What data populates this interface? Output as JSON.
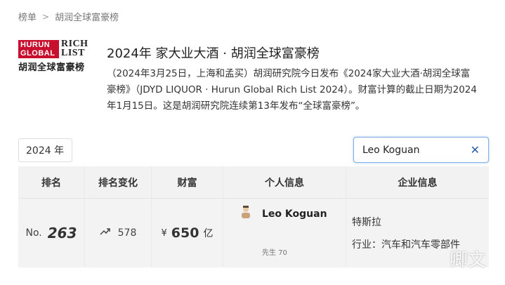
{
  "breadcrumb": {
    "items": [
      "榜单",
      "胡润全球富豪榜"
    ],
    "separator": ">"
  },
  "logo": {
    "left_text": "HURUN GLOBAL",
    "right_text": "RICH LIST",
    "cn_text": "胡润全球富豪榜"
  },
  "title": "2024年 家大业大酒 · 胡润全球富豪榜",
  "description": "（2024年3月25日，上海和孟买）胡润研究院今日发布《2024家大业大酒·胡润全球富豪榜》（JDYD LIQUOR · Hurun Global Rich List 2024）。财富计算的截止日期为2024年1月15日。这是胡润研究院连续第13年发布“全球富豪榜”。",
  "filters": {
    "year": "2024 年",
    "search_value": "Leo Koguan",
    "clear_icon": "close-icon"
  },
  "table": {
    "headers": [
      "排名",
      "排名变化",
      "财富",
      "个人信息",
      "企业信息"
    ],
    "rows": [
      {
        "rank_prefix": "No.",
        "rank": "263",
        "change_icon": "trend-up-icon",
        "change": "578",
        "currency": "¥",
        "wealth": "650",
        "unit": "亿",
        "name": "Leo Koguan",
        "meta": "先生  70",
        "company": "特斯拉",
        "industry": "行业：汽车和汽车零部件"
      }
    ]
  },
  "watermark": "卿文"
}
